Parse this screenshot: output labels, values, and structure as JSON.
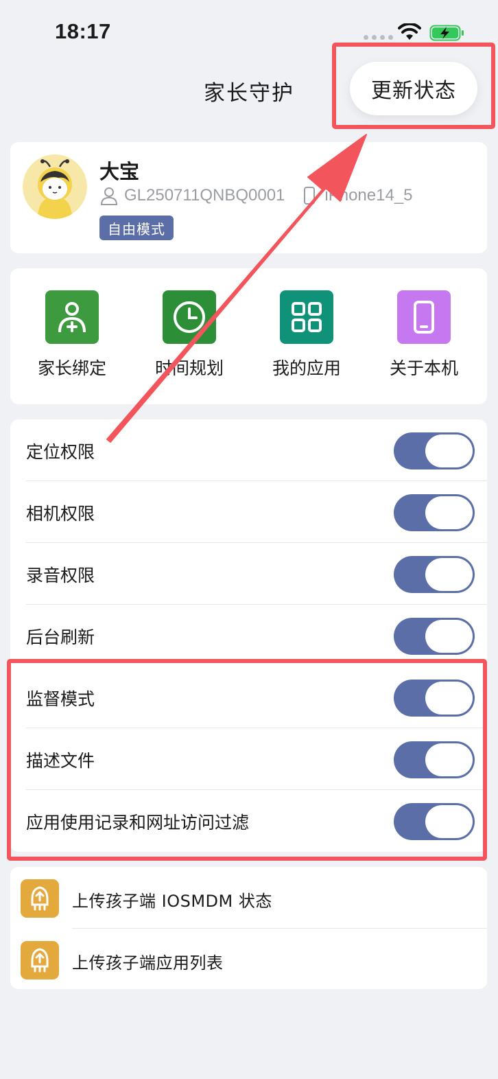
{
  "status_bar": {
    "time": "18:17"
  },
  "nav": {
    "title": "家长守护",
    "update_button": "更新状态"
  },
  "profile": {
    "name": "大宝",
    "device_id": "GL250711QNBQ0001",
    "device_model": "iPhone14_5",
    "mode_badge": "自由模式"
  },
  "features": [
    {
      "label": "家长绑定",
      "icon": "user-add-icon",
      "color": "#3d9a3f"
    },
    {
      "label": "时间规划",
      "icon": "clock-icon",
      "color": "#2c8f37"
    },
    {
      "label": "我的应用",
      "icon": "app-grid-icon",
      "color": "#0f9278"
    },
    {
      "label": "关于本机",
      "icon": "phone-icon",
      "color": "#c678f0"
    }
  ],
  "permissions": [
    {
      "label": "定位权限",
      "enabled": true
    },
    {
      "label": "相机权限",
      "enabled": true
    },
    {
      "label": "录音权限",
      "enabled": true
    },
    {
      "label": "后台刷新",
      "enabled": true
    },
    {
      "label": "监督模式",
      "enabled": true
    },
    {
      "label": "描述文件",
      "enabled": true
    },
    {
      "label": "应用使用记录和网址访问过滤",
      "enabled": true
    }
  ],
  "upload_actions": [
    {
      "label": "上传孩子端 IOSMDM 状态",
      "icon": "upload-robot-icon"
    },
    {
      "label": "上传孩子端应用列表",
      "icon": "upload-robot-icon"
    }
  ],
  "colors": {
    "background": "#f0f1f5",
    "toggle_on": "#5b6ea8",
    "highlight": "#f2555c",
    "upload_icon": "#e4a93c"
  }
}
